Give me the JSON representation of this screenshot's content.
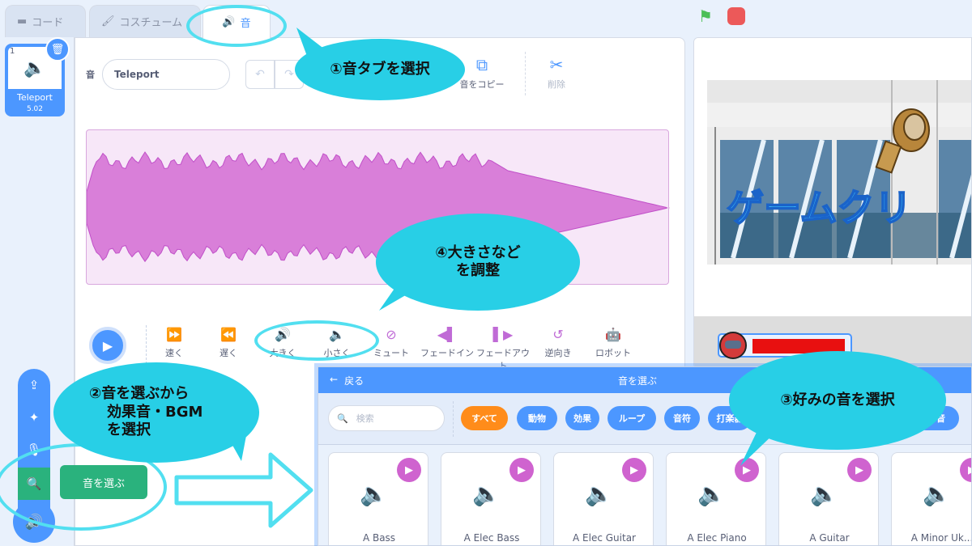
{
  "tabs": [
    {
      "label": "コード",
      "icon": "code-icon"
    },
    {
      "label": "コスチューム",
      "icon": "brush-icon"
    },
    {
      "label": "音",
      "icon": "speaker-icon"
    }
  ],
  "sprite": {
    "number": "1",
    "name": "Teleport",
    "duration": "5.02"
  },
  "editor": {
    "sound_label": "音",
    "sound_name": "Teleport",
    "copy_label": "音をコピー",
    "delete_label": "削除"
  },
  "effects": [
    {
      "label": "速く",
      "icon": "faster-icon"
    },
    {
      "label": "遅く",
      "icon": "slower-icon"
    },
    {
      "label": "大きく",
      "icon": "louder-icon"
    },
    {
      "label": "小さく",
      "icon": "softer-icon"
    },
    {
      "label": "ミュート",
      "icon": "mute-icon"
    },
    {
      "label": "フェードイン",
      "icon": "fade-in-icon"
    },
    {
      "label": "フェードアウト",
      "icon": "fade-out-icon"
    },
    {
      "label": "逆向き",
      "icon": "reverse-icon"
    },
    {
      "label": "ロボット",
      "icon": "robot-icon"
    }
  ],
  "stage": {
    "title_text": "ゲームクリ",
    "health_color": "#e81010"
  },
  "add_menu": {
    "tooltip": "音を選ぶ"
  },
  "library": {
    "back_label": "戻る",
    "title": "音を選ぶ",
    "search_placeholder": "検索",
    "categories": [
      "すべて",
      "動物",
      "効果",
      "ループ",
      "音符",
      "打楽器",
      "な音"
    ],
    "sounds": [
      "A Bass",
      "A Elec Bass",
      "A Elec Guitar",
      "A Elec Piano",
      "A Guitar",
      "A Minor Uk..."
    ]
  },
  "annotations": {
    "step1": "①音タブを選択",
    "step2_line1": "②音を選ぶから",
    "step2_line2": "効果音・BGM",
    "step2_line3": "を選択",
    "step3": "③好みの音を選択",
    "step4_line1": "④大きさなど",
    "step4_line2": "を調整"
  },
  "colors": {
    "accent": "#4c97ff",
    "annotation": "#28cfe6",
    "waveform": "#d97fd9",
    "selected_chip": "#ff8c1a"
  }
}
